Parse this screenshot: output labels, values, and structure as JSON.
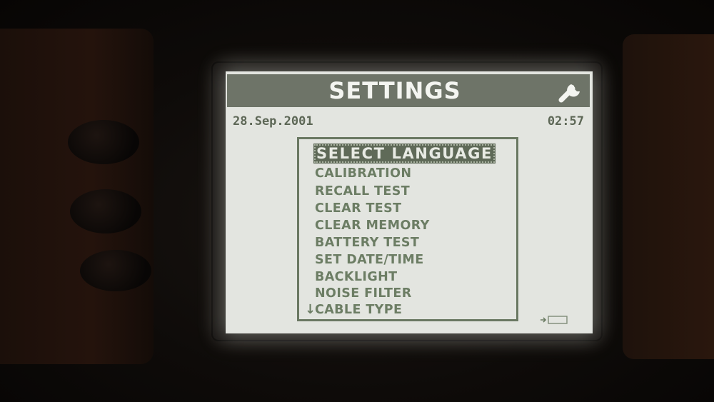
{
  "screen": {
    "title": "SETTINGS",
    "title_icon": "wrench-icon",
    "date": "28.Sep.2001",
    "time": "02:57",
    "menu": {
      "selected_index": 0,
      "items": [
        {
          "label": "SELECT LANGUAGE"
        },
        {
          "label": "CALIBRATION"
        },
        {
          "label": "RECALL TEST"
        },
        {
          "label": "CLEAR TEST"
        },
        {
          "label": "CLEAR MEMORY"
        },
        {
          "label": "BATTERY TEST"
        },
        {
          "label": "SET DATE/TIME"
        },
        {
          "label": "BACKLIGHT"
        },
        {
          "label": "NOISE FILTER"
        },
        {
          "label": "CABLE TYPE"
        }
      ],
      "more_below_icon": "arrow-down-icon"
    },
    "status_icon": "battery-icon"
  },
  "colors": {
    "lcd_background": "#e3e5e0",
    "lcd_foreground": "#6c7d64",
    "title_bar": "#6e7468"
  }
}
